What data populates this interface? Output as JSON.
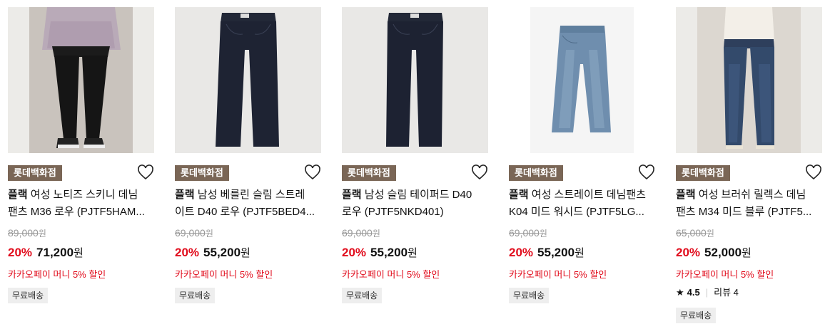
{
  "products": [
    {
      "store": "롯데백화점",
      "brand": "플랙",
      "title_line1": " 여성 노티즈 스키니 데님",
      "title_line2": "팬츠 M36 로우 (PJTF5HAM...",
      "original_price": "89,000",
      "discount": "20%",
      "sale_price": "71,200",
      "currency": "원",
      "promo": "카카오페이 머니 5% 할인",
      "shipping": "무료배송",
      "image": "woman-black-skinny-jeans"
    },
    {
      "store": "롯데백화점",
      "brand": "플랙",
      "title_line1": " 남성 베를린 슬림 스트레",
      "title_line2": "이트 D40 로우 (PJTF5BED4...",
      "original_price": "69,000",
      "discount": "20%",
      "sale_price": "55,200",
      "currency": "원",
      "promo": "카카오페이 머니 5% 할인",
      "shipping": "무료배송",
      "image": "dark-indigo-jeans"
    },
    {
      "store": "롯데백화점",
      "brand": "플랙",
      "title_line1": " 남성 슬림 테이퍼드 D40",
      "title_line2": "로우 (PJTF5NKD401)",
      "original_price": "69,000",
      "discount": "20%",
      "sale_price": "55,200",
      "currency": "원",
      "promo": "카카오페이 머니 5% 할인",
      "shipping": "무료배송",
      "image": "dark-indigo-jeans"
    },
    {
      "store": "롯데백화점",
      "brand": "플랙",
      "title_line1": " 여성 스트레이트 데님팬츠",
      "title_line2": "K04 미드 워시드 (PJTF5LG...",
      "original_price": "69,000",
      "discount": "20%",
      "sale_price": "55,200",
      "currency": "원",
      "promo": "카카오페이 머니 5% 할인",
      "shipping": "무료배송",
      "image": "light-wash-jeans"
    },
    {
      "store": "롯데백화점",
      "brand": "플랙",
      "title_line1": " 여성 브러쉬 릴렉스 데님",
      "title_line2": "팬츠 M34 미드 블루 (PJTF5...",
      "original_price": "65,000",
      "discount": "20%",
      "sale_price": "52,000",
      "currency": "원",
      "promo": "카카오페이 머니 5% 할인",
      "shipping": "무료배송",
      "rating": "4.5",
      "review_label": "리뷰 4",
      "image": "woman-mid-blue-jeans"
    }
  ],
  "icons": {
    "wish": "heart-outline-icon",
    "star": "star-icon"
  }
}
